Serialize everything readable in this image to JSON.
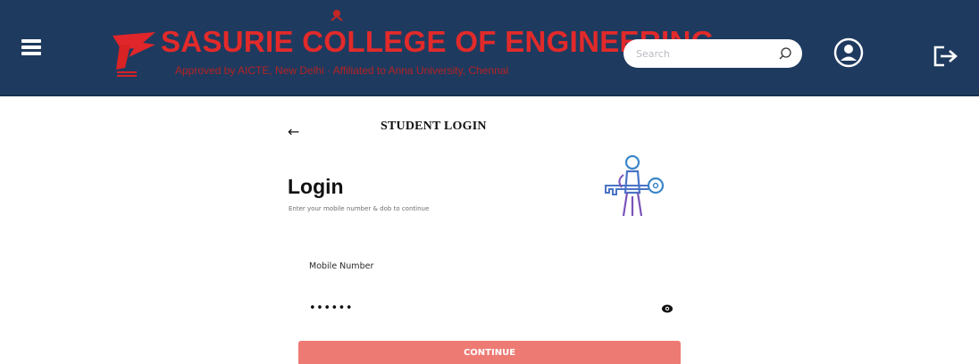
{
  "header": {
    "college_name": "SASURIE COLLEGE OF ENGINEERING",
    "college_subtitle": "Approved by AICTE, New Delhi · Affiliated to Anna University, Chennai",
    "search_placeholder": "Search",
    "colors": {
      "background": "#1f3a5f",
      "name": "#e22a2a"
    }
  },
  "icons": {
    "menu": "hamburger-menu-icon",
    "search": "search-icon",
    "user": "user-profile-icon",
    "logout": "logout-icon",
    "back": "back-arrow-icon",
    "password_toggle": "eye-icon",
    "illustration": "person-with-key-icon"
  },
  "login": {
    "back_symbol": "←",
    "page_title": "STUDENT LOGIN",
    "heading": "Login",
    "subheading": "Enter your mobile number & dob to continue",
    "mobile_label": "Mobile Number",
    "mobile_value": "",
    "password_value": "••••••",
    "continue_label": "CONTINUE",
    "button_color": "#ee7a74"
  }
}
